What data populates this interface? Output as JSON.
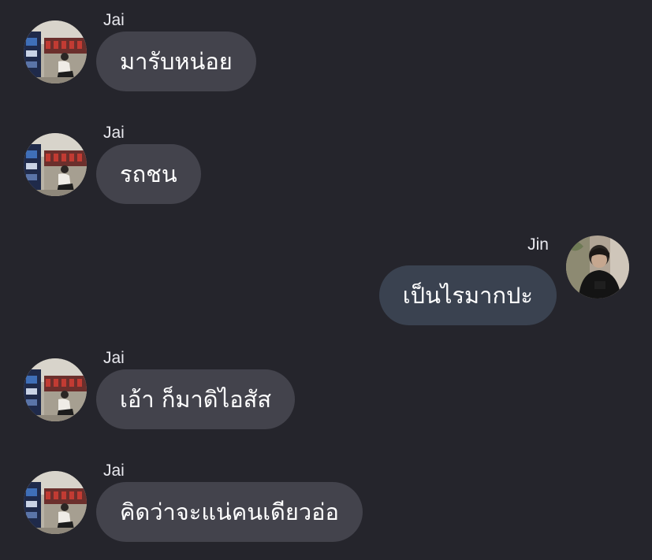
{
  "messages": [
    {
      "sender": "Jai",
      "text": "มารับหน่อย",
      "direction": "incoming",
      "avatar": "jai-avatar"
    },
    {
      "sender": "Jai",
      "text": "รถชน",
      "direction": "incoming",
      "avatar": "jai-avatar"
    },
    {
      "sender": "Jin",
      "text": "เป็นไรมากปะ",
      "direction": "outgoing",
      "avatar": "jin-avatar"
    },
    {
      "sender": "Jai",
      "text": "เอ้า ก็มาดิไอสัส",
      "direction": "incoming",
      "avatar": "jai-avatar"
    },
    {
      "sender": "Jai",
      "text": "คิดว่าจะแน่คนเดียวอ่อ",
      "direction": "incoming",
      "avatar": "jai-avatar"
    }
  ],
  "colors": {
    "background": "#25252c",
    "incoming_bubble": "#43434c",
    "outgoing_bubble": "#3a4250",
    "text": "#ffffff"
  }
}
